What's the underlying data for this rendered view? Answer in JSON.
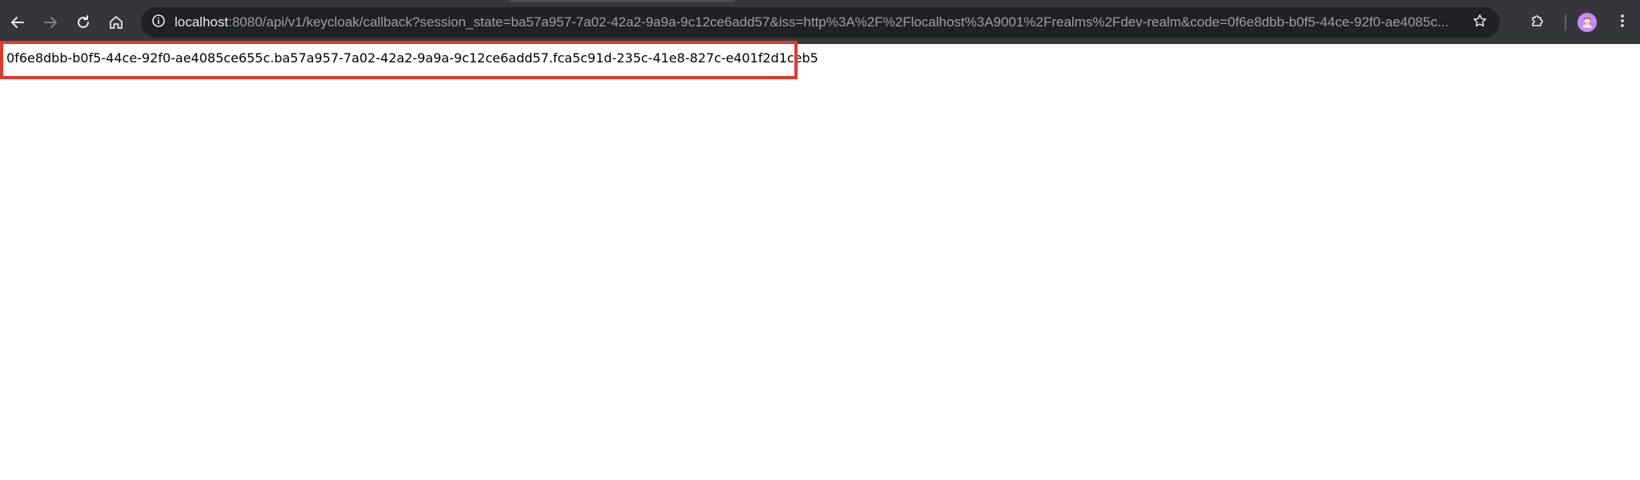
{
  "browser": {
    "url_host": "localhost",
    "url_rest": ":8080/api/v1/keycloak/callback?session_state=ba57a957-7a02-42a2-9a9a-9c12ce6add57&iss=http%3A%2F%2Flocalhost%3A9001%2Frealms%2Fdev-realm&code=0f6e8dbb-b0f5-44ce-92f0-ae4085c...",
    "icons": {
      "back": "arrow-left-icon",
      "forward": "arrow-right-icon",
      "reload": "reload-icon",
      "home": "home-icon",
      "site_info": "info-icon",
      "bookmark": "star-icon",
      "extensions": "puzzle-icon",
      "menu": "more-vert-icon"
    },
    "colors": {
      "toolbar": "#35363a",
      "omnibox": "#202124",
      "highlight": "#e23a2a"
    }
  },
  "page": {
    "body_text": "0f6e8dbb-b0f5-44ce-92f0-ae4085ce655c.ba57a957-7a02-42a2-9a9a-9c12ce6add57.fca5c91d-235c-41e8-827c-e401f2d1ceb5"
  }
}
